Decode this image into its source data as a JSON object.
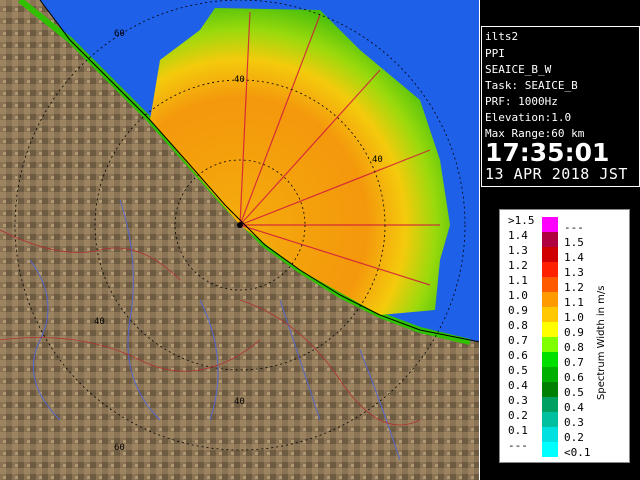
{
  "info": {
    "station": "ilts2",
    "mode": "PPI",
    "scan_name": "SEAICE_B_W",
    "task": "Task: SEAICE_B",
    "prf": "PRF: 1000Hz",
    "elevation": "Elevation:1.0",
    "max_range": "Max Range:60 km",
    "time": "17:35:01",
    "date": "13 APR 2018 JST"
  },
  "range_labels": [
    "60",
    "40",
    "40",
    "40",
    "40",
    "60"
  ],
  "legend": {
    "title": "Spectrum Width in m/s",
    "left_labels": [
      ">1.5",
      "1.4",
      "1.3",
      "1.2",
      "1.1",
      "1.0",
      "0.9",
      "0.8",
      "0.7",
      "0.6",
      "0.5",
      "0.4",
      "0.3",
      "0.2",
      "0.1",
      "---"
    ],
    "right_labels": [
      "---",
      "1.5",
      "1.4",
      "1.3",
      "1.2",
      "1.1",
      "1.0",
      "0.9",
      "0.8",
      "0.7",
      "0.6",
      "0.5",
      "0.4",
      "0.3",
      "0.2",
      "<0.1"
    ],
    "colors": [
      "#ff00ff",
      "#b00040",
      "#d00000",
      "#ff2000",
      "#ff5a00",
      "#ff9a00",
      "#ffc800",
      "#ffff00",
      "#80ff00",
      "#00e000",
      "#00b000",
      "#008000",
      "#00a060",
      "#00c0a0",
      "#00e0e0",
      "#00ffff"
    ]
  },
  "colors": {
    "land": "#8a7455",
    "sea": "#1e60e8",
    "panel_border": "#ffffff"
  }
}
